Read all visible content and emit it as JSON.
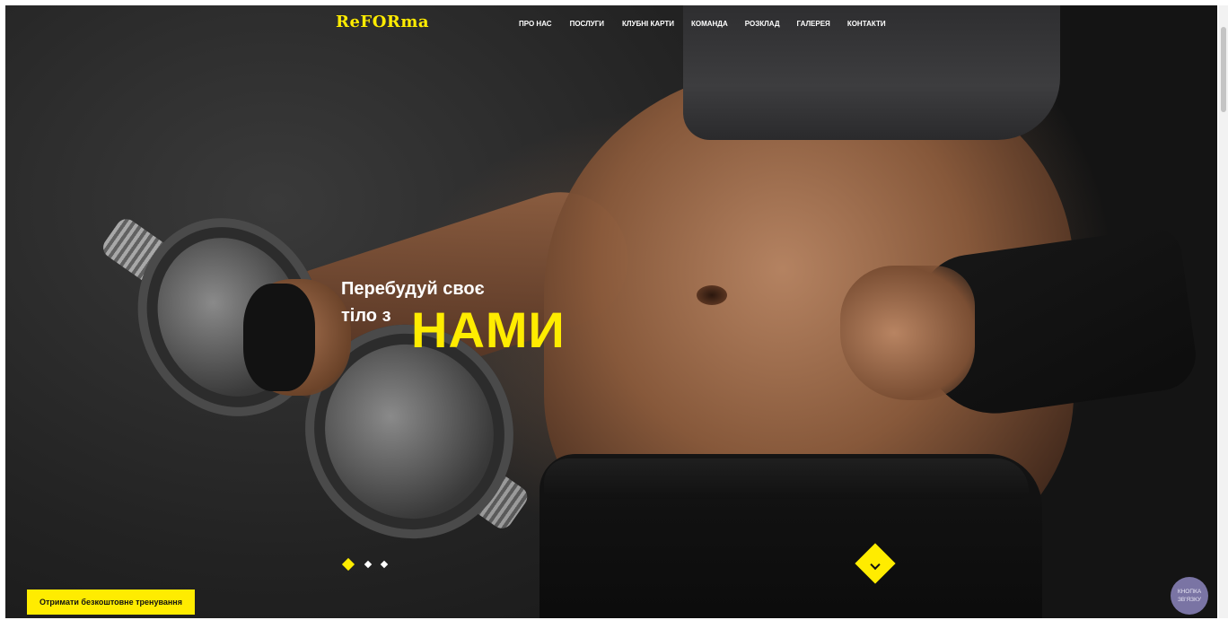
{
  "header": {
    "logo": "ReFORma",
    "nav": [
      {
        "label": "ПРО НАС"
      },
      {
        "label": "ПОСЛУГИ"
      },
      {
        "label": "КЛУБНІ КАРТИ"
      },
      {
        "label": "КОМАНДА"
      },
      {
        "label": "РОЗКЛАД"
      },
      {
        "label": "ГАЛЕРЕЯ"
      },
      {
        "label": "КОНТАКТИ"
      }
    ]
  },
  "hero": {
    "line1": "Перебудуй своє",
    "line2": "тіло з",
    "highlight": "НАМИ",
    "slides_total": 3,
    "active_slide": 1,
    "scroll_icon": "chevron-down-icon"
  },
  "cta": {
    "label": "Отримати безкоштовне тренування"
  },
  "contact": {
    "line1": "КНОПКА",
    "line2": "ЗВ'ЯЗКУ"
  },
  "colors": {
    "accent": "#ffec00",
    "contact_bg": "#7a74a4",
    "text": "#ffffff"
  }
}
